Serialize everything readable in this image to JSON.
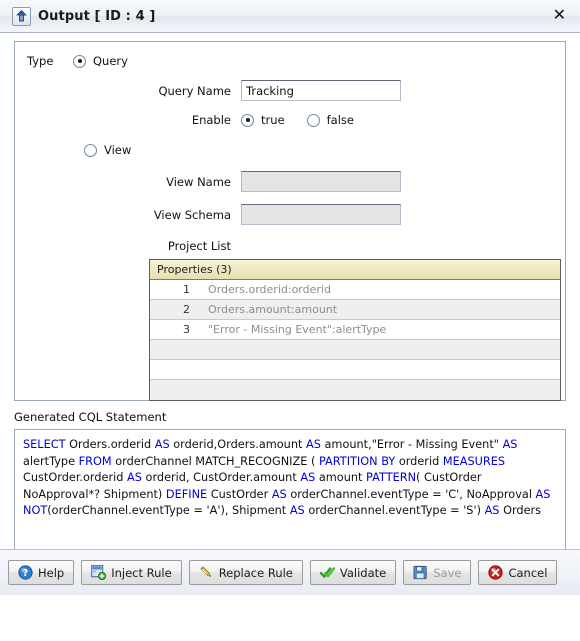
{
  "window": {
    "title": "Output [ ID : 4 ]",
    "icon": "output-arrow-icon",
    "close_label": "✕"
  },
  "form": {
    "type_label": "Type",
    "query_radio_label": "Query",
    "query_radio_selected": true,
    "query_name_label": "Query Name",
    "query_name_value": "Tracking",
    "enable_label": "Enable",
    "enable_true_label": "true",
    "enable_false_label": "false",
    "enable_selected": "true",
    "view_radio_label": "View",
    "view_radio_selected": false,
    "view_name_label": "View Name",
    "view_name_value": "",
    "view_name_placeholder": "",
    "view_schema_label": "View Schema",
    "view_schema_value": "",
    "view_schema_placeholder": "",
    "project_list_label": "Project List"
  },
  "properties_table": {
    "header": "Properties (3)",
    "header_color": "#efe9c2",
    "rows": [
      {
        "num": "1",
        "value": "Orders.orderid:orderid"
      },
      {
        "num": "2",
        "value": "Orders.amount:amount"
      },
      {
        "num": "3",
        "value": "\"Error - Missing Event\":alertType"
      },
      {
        "num": "",
        "value": ""
      },
      {
        "num": "",
        "value": ""
      },
      {
        "num": "",
        "value": ""
      }
    ]
  },
  "cql": {
    "label": "Generated CQL Statement",
    "keyword_color": "#0000d8",
    "tokens": [
      {
        "t": "SELECT",
        "kw": true
      },
      {
        "t": " Orders.orderid ",
        "kw": false
      },
      {
        "t": "AS",
        "kw": true
      },
      {
        "t": " orderid,Orders.amount ",
        "kw": false
      },
      {
        "t": "AS",
        "kw": true
      },
      {
        "t": " amount,\"Error - Missing Event\" ",
        "kw": false
      },
      {
        "t": "AS",
        "kw": true
      },
      {
        "t": " alertType ",
        "kw": false
      },
      {
        "t": "FROM",
        "kw": true
      },
      {
        "t": " orderChannel  MATCH_RECOGNIZE ( ",
        "kw": false
      },
      {
        "t": "PARTITION BY",
        "kw": true
      },
      {
        "t": " orderid ",
        "kw": false
      },
      {
        "t": "MEASURES",
        "kw": true
      },
      {
        "t": " CustOrder.orderid ",
        "kw": false
      },
      {
        "t": "AS",
        "kw": true
      },
      {
        "t": " orderid, CustOrder.amount ",
        "kw": false
      },
      {
        "t": "AS",
        "kw": true
      },
      {
        "t": " amount ",
        "kw": false
      },
      {
        "t": "PATTERN",
        "kw": true
      },
      {
        "t": "( CustOrder NoApproval*? Shipment) ",
        "kw": false
      },
      {
        "t": "DEFINE",
        "kw": true
      },
      {
        "t": " CustOrder ",
        "kw": false
      },
      {
        "t": "AS",
        "kw": true
      },
      {
        "t": " orderChannel.eventType = 'C', NoApproval ",
        "kw": false
      },
      {
        "t": "AS",
        "kw": true
      },
      {
        "t": " ",
        "kw": false
      },
      {
        "t": "NOT",
        "kw": true
      },
      {
        "t": "(orderChannel.eventType = 'A'), Shipment ",
        "kw": false
      },
      {
        "t": "AS",
        "kw": true
      },
      {
        "t": " orderChannel.eventType = 'S') ",
        "kw": false
      },
      {
        "t": "AS",
        "kw": true
      },
      {
        "t": " Orders",
        "kw": false
      }
    ],
    "plain_text": "SELECT Orders.orderid AS orderid,Orders.amount AS amount,\"Error - Missing Event\" AS alertType FROM orderChannel  MATCH_RECOGNIZE ( PARTITION BY orderid MEASURES CustOrder.orderid AS orderid, CustOrder.amount AS amount PATTERN( CustOrder NoApproval*? Shipment) DEFINE CustOrder AS orderChannel.eventType = 'C', NoApproval AS NOT(orderChannel.eventType = 'A'), Shipment AS orderChannel.eventType = 'S') AS Orders"
  },
  "buttons": [
    {
      "label": "Help",
      "icon": "help-question-icon",
      "disabled": false
    },
    {
      "label": "Inject Rule",
      "icon": "inject-rule-grid-add-icon",
      "disabled": false
    },
    {
      "label": "Replace Rule",
      "icon": "replace-rule-pencil-icon",
      "disabled": false
    },
    {
      "label": "Validate",
      "icon": "validate-checkmark-icon",
      "disabled": false
    },
    {
      "label": "Save",
      "icon": "save-floppy-icon",
      "disabled": true
    },
    {
      "label": "Cancel",
      "icon": "cancel-x-icon",
      "disabled": false
    }
  ]
}
